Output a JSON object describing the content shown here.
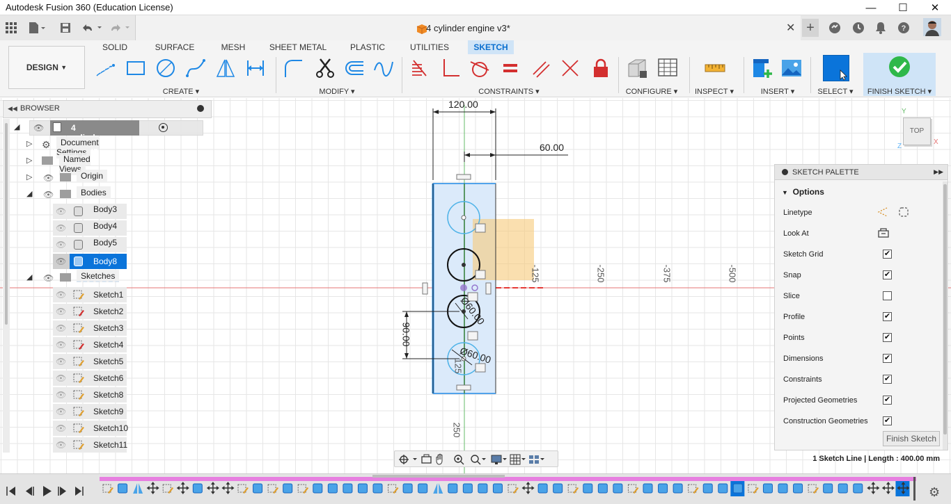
{
  "window": {
    "title": "Autodesk Fusion 360 (Education License)"
  },
  "document": {
    "tab_name": "4 cylinder engine v3*"
  },
  "ribbon": {
    "workspace": "DESIGN",
    "tabs": [
      "SOLID",
      "SURFACE",
      "MESH",
      "SHEET METAL",
      "PLASTIC",
      "UTILITIES",
      "SKETCH"
    ],
    "active_tab": "SKETCH",
    "groups": {
      "create": "CREATE",
      "modify": "MODIFY",
      "constraints": "CONSTRAINTS",
      "configure": "CONFIGURE",
      "inspect": "INSPECT",
      "insert": "INSERT",
      "select": "SELECT",
      "finish": "FINISH SKETCH"
    }
  },
  "browser": {
    "title": "BROWSER",
    "root": "4 cylinder engine v3",
    "nodes": {
      "document_settings": "Document Settings",
      "named_views": "Named Views",
      "origin": "Origin",
      "bodies": "Bodies",
      "sketches": "Sketches"
    },
    "bodies": [
      "Body3",
      "Body4",
      "Body5",
      "Body8"
    ],
    "selected_body": "Body8",
    "sketches": [
      "Sketch1",
      "Sketch2",
      "Sketch3",
      "Sketch4",
      "Sketch5",
      "Sketch6",
      "Sketch8",
      "Sketch9",
      "Sketch10",
      "Sketch11"
    ]
  },
  "canvas": {
    "dimensions": {
      "width": "120.00",
      "offset": "60.00",
      "spacing": "90.00",
      "diameter_1": "Ø60.00",
      "diameter_2": "Ø60.00"
    },
    "axis_labels": {
      "h1": "-125",
      "h2": "-250",
      "h3": "-375",
      "h4": "-500",
      "v1": "250",
      "v2": "125"
    },
    "viewcube": {
      "face": "TOP",
      "x": "X",
      "y": "Y",
      "z": "Z"
    }
  },
  "palette": {
    "title": "SKETCH PALETTE",
    "section": "Options",
    "rows": [
      {
        "label": "Linetype",
        "kind": "icons"
      },
      {
        "label": "Look At",
        "kind": "icon"
      },
      {
        "label": "Sketch Grid",
        "checked": true
      },
      {
        "label": "Snap",
        "checked": true
      },
      {
        "label": "Slice",
        "checked": false
      },
      {
        "label": "Profile",
        "checked": true
      },
      {
        "label": "Points",
        "checked": true
      },
      {
        "label": "Dimensions",
        "checked": true
      },
      {
        "label": "Constraints",
        "checked": true
      },
      {
        "label": "Projected Geometries",
        "checked": true
      },
      {
        "label": "Construction Geometries",
        "checked": true
      }
    ],
    "finish_button": "Finish Sketch"
  },
  "status": {
    "text": "1 Sketch Line | Length : 400.00 mm"
  },
  "colors": {
    "accent": "#0a74da",
    "finish_green": "#2fb84a",
    "sketch_blue": "#1e88e5",
    "profile_fill": "#f7c97a",
    "x_axis": "#e53935",
    "y_axis": "#43a047"
  }
}
